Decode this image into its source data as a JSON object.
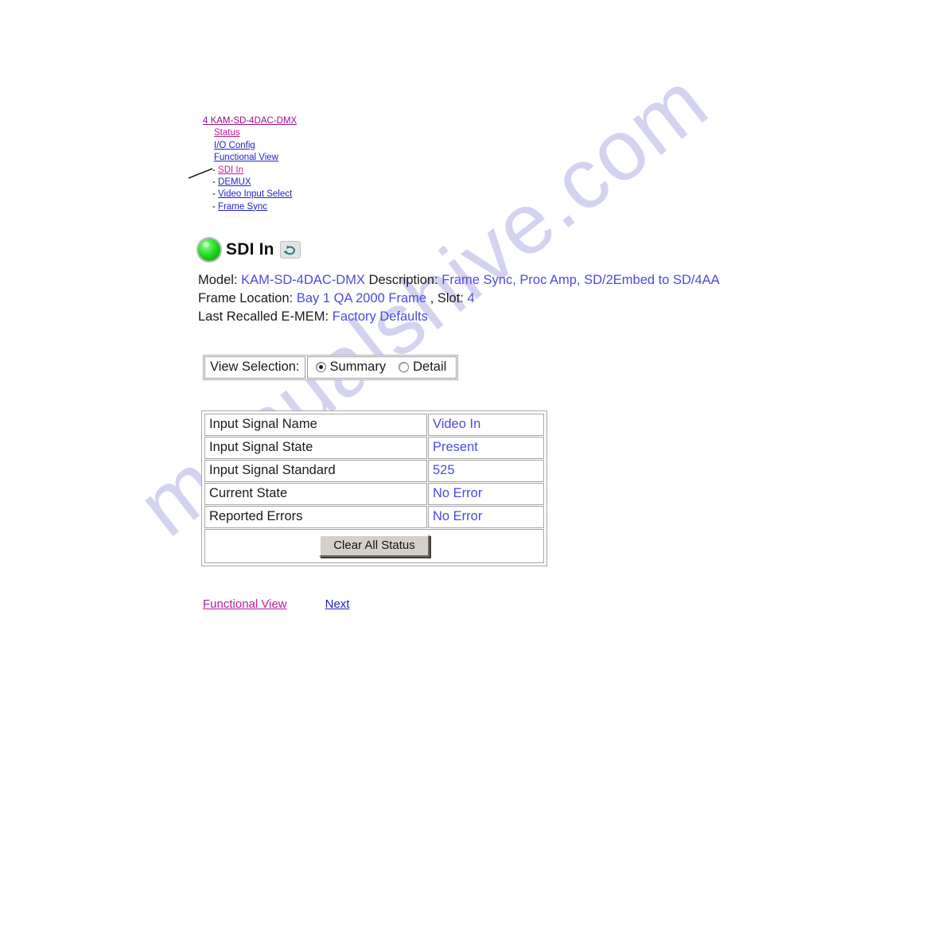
{
  "watermark": {
    "text": "manualshive.com"
  },
  "nav_tree": {
    "root": {
      "label": "4 KAM-SD-4DAC-DMX",
      "state": "visited"
    },
    "level1": [
      {
        "label": "Status",
        "state": "visited"
      },
      {
        "label": "I/O Config",
        "state": "link"
      },
      {
        "label": "Functional View",
        "state": "link"
      }
    ],
    "level2": [
      {
        "dash": "-",
        "label": "SDI In",
        "state": "visited"
      },
      {
        "dash": "-",
        "label": "DEMUX",
        "state": "link"
      },
      {
        "dash": "-",
        "label": "Video Input Select",
        "state": "link"
      },
      {
        "dash": "-",
        "label": "Frame Sync",
        "state": "link"
      }
    ]
  },
  "header": {
    "title": "SDI In",
    "led_icon": "green-led-icon",
    "led_color": "#2ee02e",
    "refresh_icon": "refresh-icon",
    "refresh_color": "#1f7b86"
  },
  "info": {
    "model_label": "Model:",
    "model_value": "KAM-SD-4DAC-DMX",
    "description_label": "Description:",
    "description_value": "Frame Sync, Proc Amp, SD/2Embed to SD/4AA",
    "frame_location_label": "Frame Location:",
    "frame_location_value": "Bay 1 QA 2000 Frame",
    "slot_label": ", Slot:",
    "slot_value": "4",
    "emem_label": "Last Recalled E-MEM:",
    "emem_value": "Factory Defaults"
  },
  "view_selection": {
    "label": "View Selection:",
    "options": [
      {
        "label": "Summary",
        "selected": true
      },
      {
        "label": "Detail",
        "selected": false
      }
    ]
  },
  "status_table": {
    "rows": [
      {
        "key": "Input Signal Name",
        "value": "Video In"
      },
      {
        "key": "Input Signal State",
        "value": "Present"
      },
      {
        "key": "Input Signal Standard",
        "value": "525"
      },
      {
        "key": "Current State",
        "value": "No Error"
      },
      {
        "key": "Reported Errors",
        "value": "No Error"
      }
    ],
    "button_label": "Clear All Status"
  },
  "bottom_links": [
    {
      "label": "Functional View",
      "state": "visited"
    },
    {
      "label": "Next",
      "state": "link"
    }
  ],
  "colors": {
    "link": "#2222cc",
    "visited": "#c0199c",
    "value_blue": "#4a4ae0",
    "watermark": "#ccccee"
  }
}
